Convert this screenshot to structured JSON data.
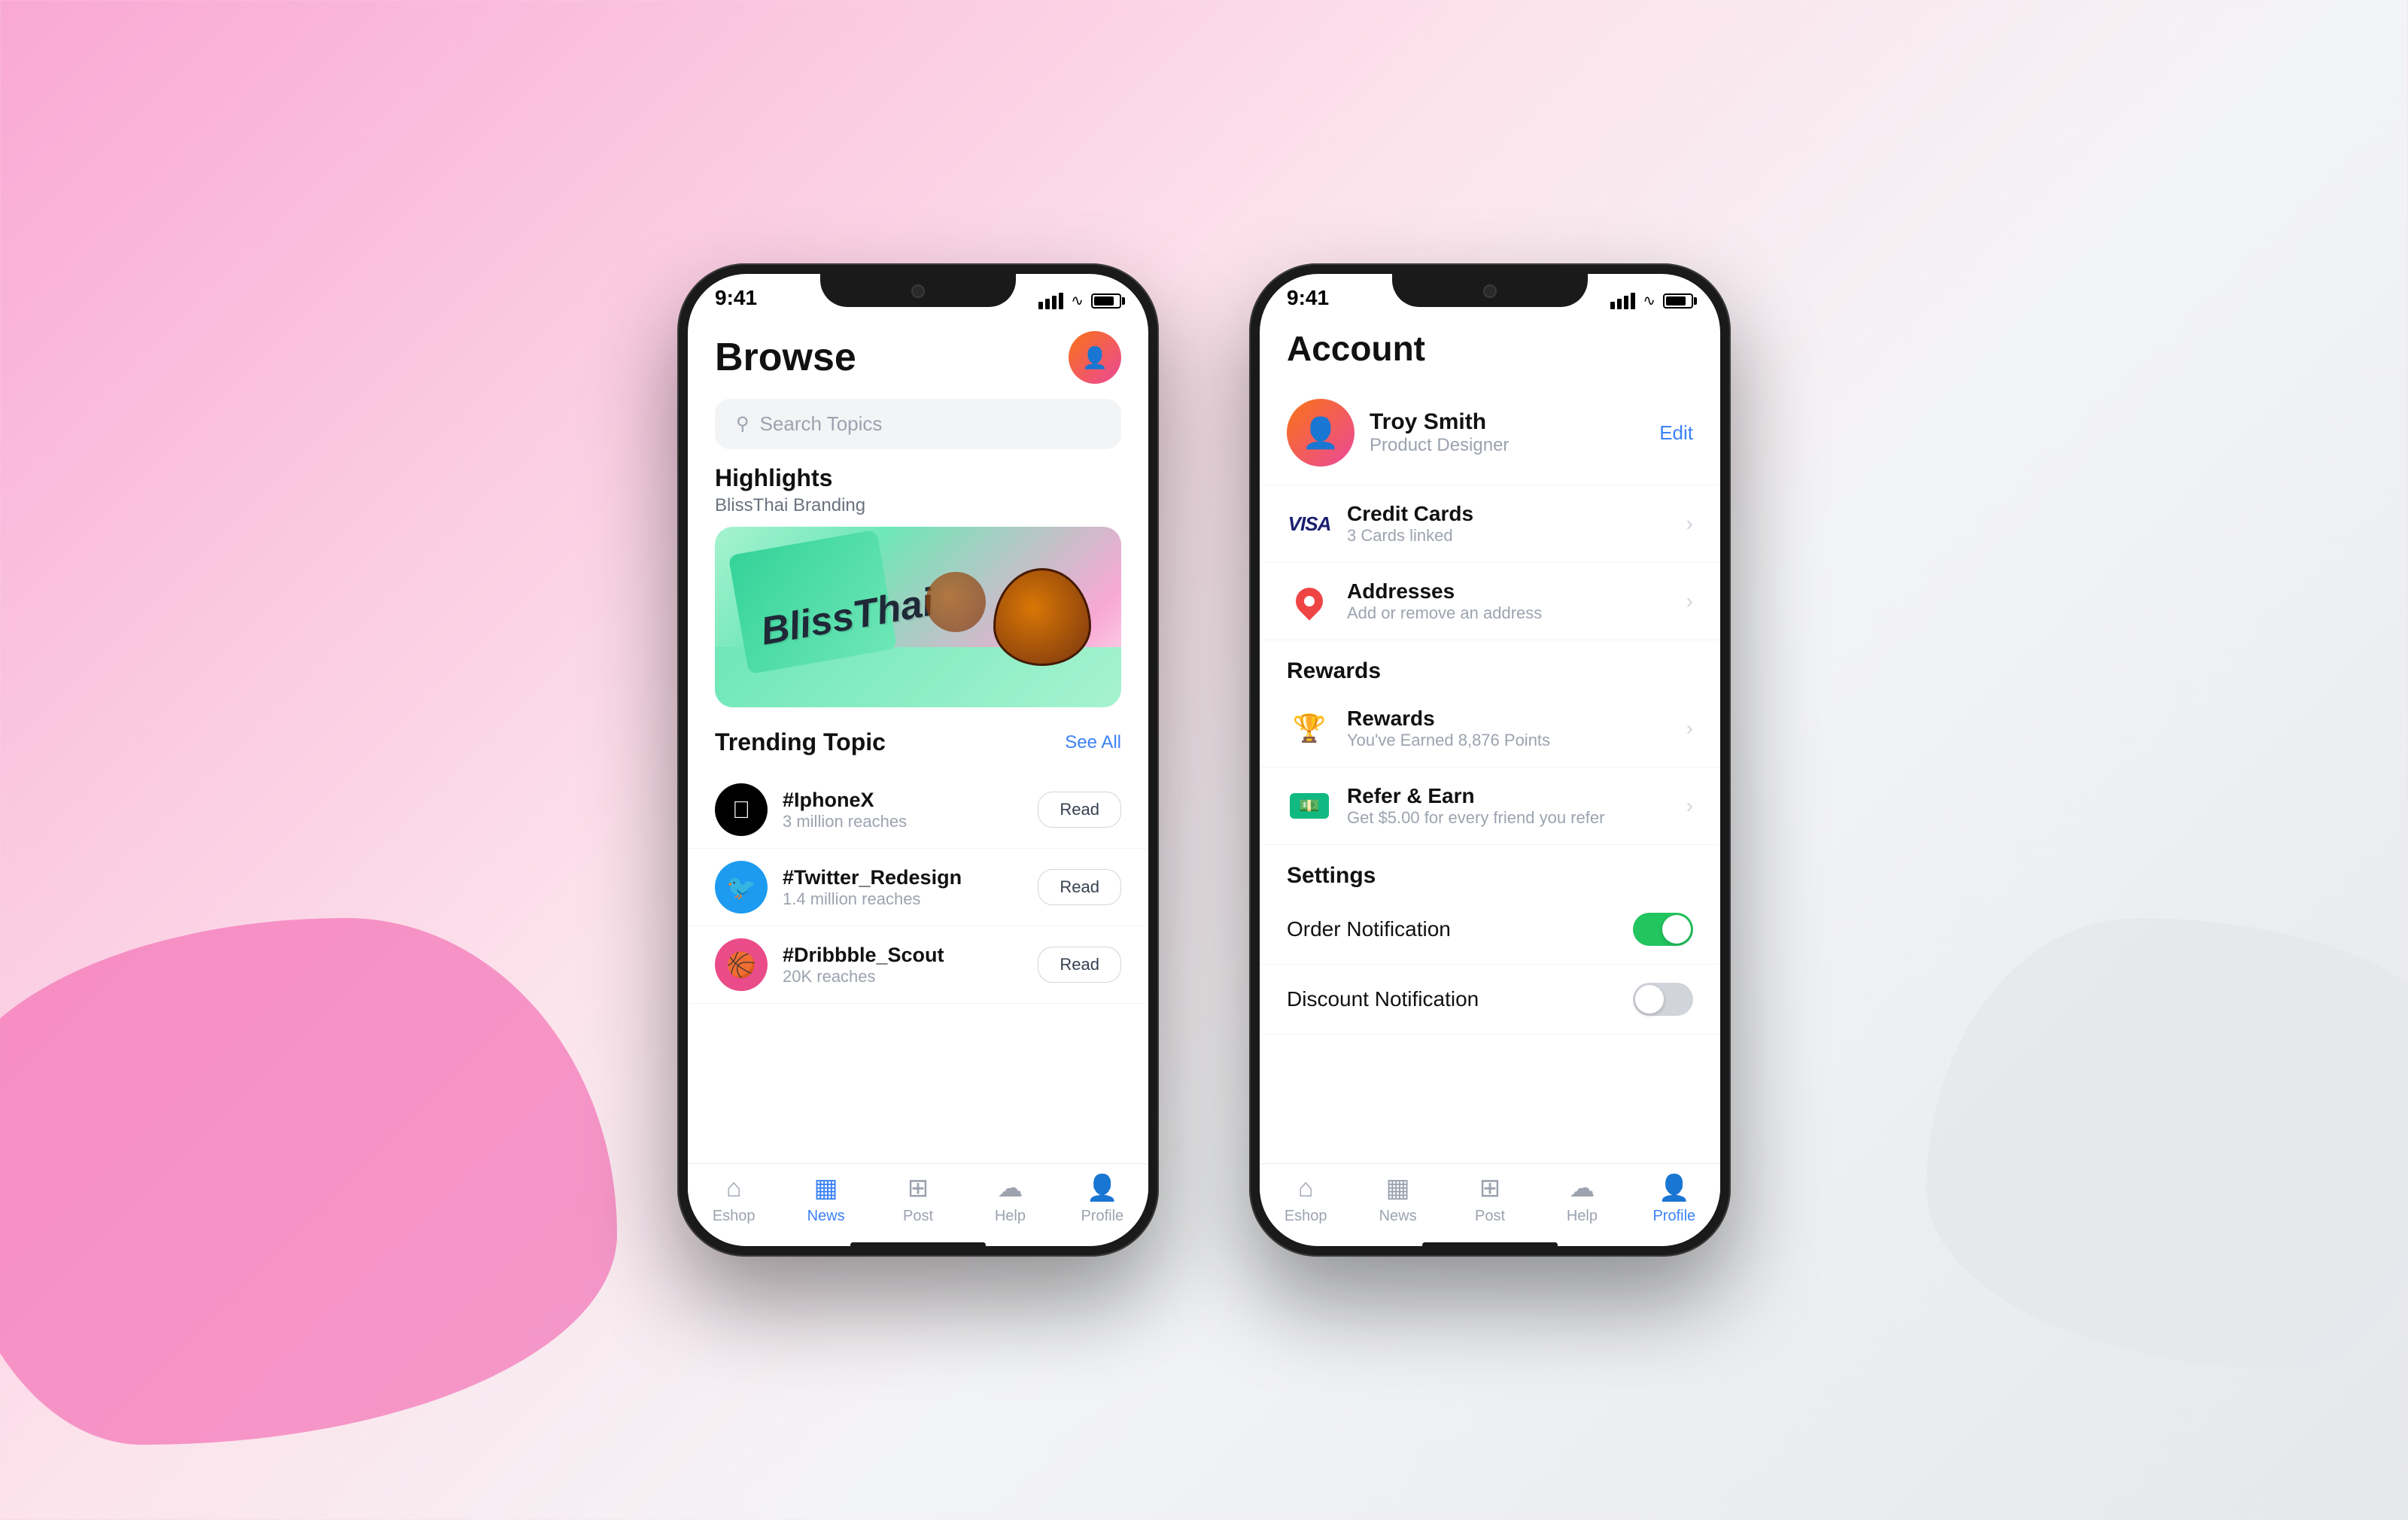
{
  "background": {
    "color_left": "#f9a8d4",
    "color_right": "#e5e7eb"
  },
  "phone1": {
    "status_bar": {
      "time": "9:41",
      "signal": 4,
      "wifi": true,
      "battery": 80
    },
    "browse": {
      "title": "Browse",
      "search_placeholder": "Search Topics",
      "highlights_label": "Highlights",
      "highlights_sub": "BlissThai Branding",
      "trending_label": "Trending Topic",
      "see_all_label": "See All",
      "topics": [
        {
          "name": "#IphoneX",
          "reach": "3 million reaches",
          "icon": ""
        },
        {
          "name": "#Twitter_Redesign",
          "reach": "1.4 million reaches",
          "icon": ""
        },
        {
          "name": "#Dribbble_Scout",
          "reach": "20K reaches",
          "icon": ""
        }
      ],
      "read_label": "Read"
    },
    "tab_bar": {
      "items": [
        {
          "label": "Eshop",
          "icon": "home"
        },
        {
          "label": "News",
          "icon": "news",
          "active": true
        },
        {
          "label": "Post",
          "icon": "post"
        },
        {
          "label": "Help",
          "icon": "help"
        },
        {
          "label": "Profile",
          "icon": "profile"
        }
      ]
    }
  },
  "phone2": {
    "status_bar": {
      "time": "9:41",
      "signal": 4,
      "wifi": true,
      "battery": 80
    },
    "account": {
      "title": "Account",
      "profile": {
        "name": "Troy Smith",
        "role": "Product Designer",
        "edit_label": "Edit"
      },
      "sections": [
        {
          "items": [
            {
              "id": "credit_cards",
              "title": "Credit Cards",
              "subtitle": "3 Cards linked",
              "icon_type": "visa"
            },
            {
              "id": "addresses",
              "title": "Addresses",
              "subtitle": "Add or remove an address",
              "icon_type": "location"
            }
          ]
        }
      ],
      "rewards_title": "Rewards",
      "rewards_items": [
        {
          "id": "rewards",
          "title": "Rewards",
          "subtitle": "You've Earned 8,876 Points",
          "icon_type": "trophy"
        },
        {
          "id": "refer",
          "title": "Refer & Earn",
          "subtitle": "Get $5.00 for every friend you refer",
          "icon_type": "money"
        }
      ],
      "settings_title": "Settings",
      "settings_items": [
        {
          "id": "order_notification",
          "label": "Order Notification",
          "enabled": true
        },
        {
          "id": "discount_notification",
          "label": "Discount Notification",
          "enabled": false
        }
      ]
    },
    "tab_bar": {
      "items": [
        {
          "label": "Eshop",
          "icon": "home"
        },
        {
          "label": "News",
          "icon": "news"
        },
        {
          "label": "Post",
          "icon": "post"
        },
        {
          "label": "Help",
          "icon": "help"
        },
        {
          "label": "Profile",
          "icon": "profile",
          "active": true
        }
      ]
    }
  }
}
